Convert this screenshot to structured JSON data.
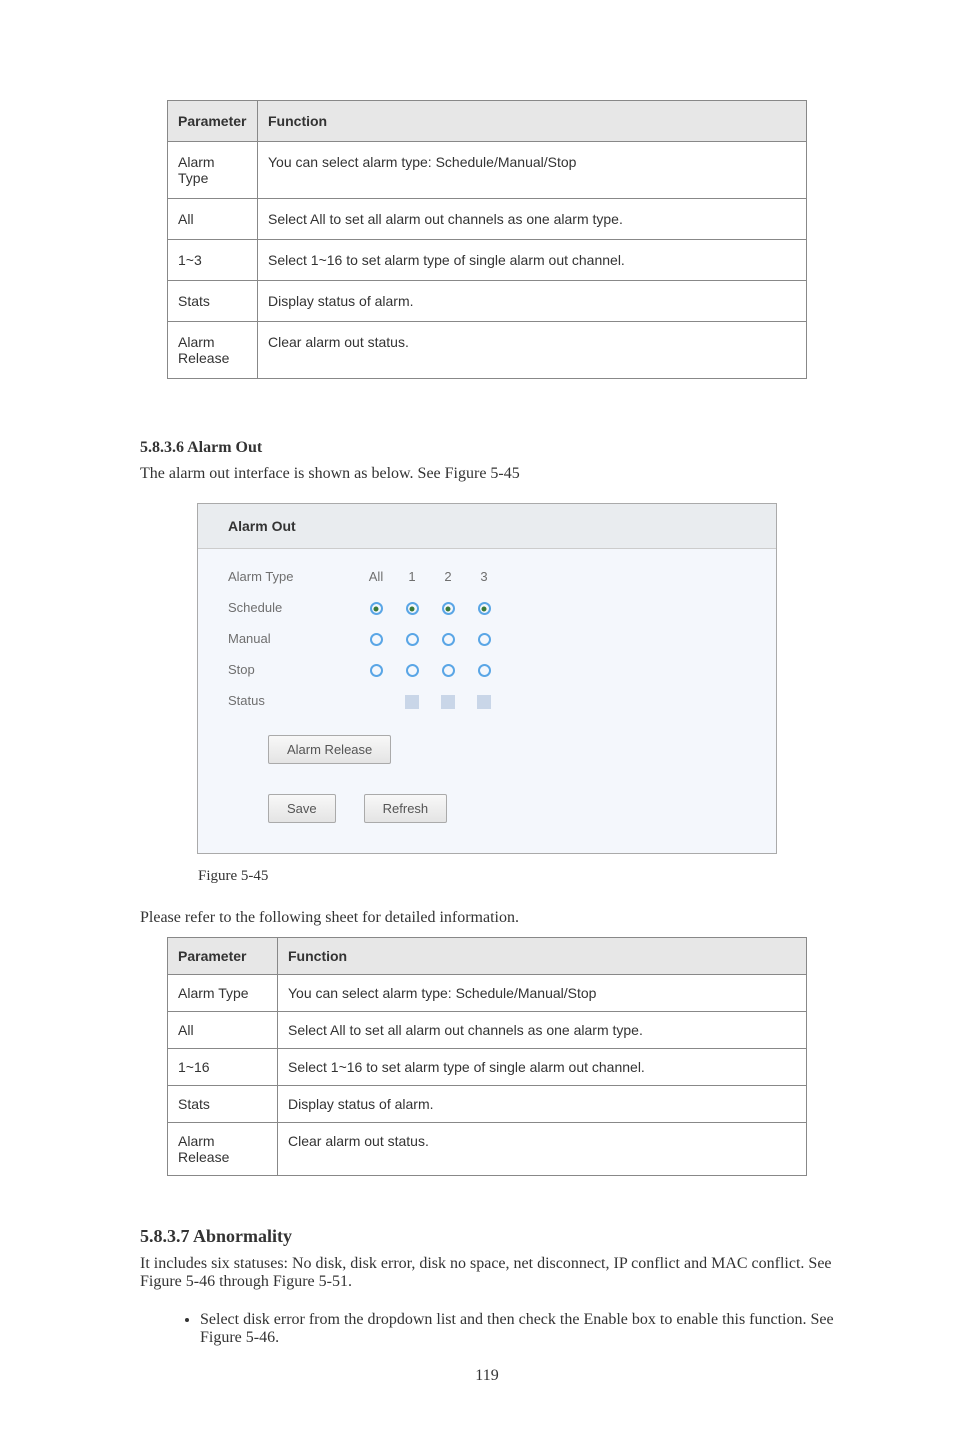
{
  "table1": {
    "headers": [
      "Parameter",
      "Function"
    ],
    "rows": [
      [
        "Alarm Type",
        "You can select alarm type: Schedule/Manual/Stop"
      ],
      [
        "All",
        "Select All to set all alarm out channels as one alarm type."
      ],
      [
        "1~3",
        "Select 1~16 to set alarm type of single alarm out channel."
      ],
      [
        "Stats",
        "Display status of alarm."
      ],
      [
        "Alarm Release",
        "Clear alarm out status."
      ]
    ]
  },
  "section1": {
    "num": "5.8.3.6",
    "title": "Alarm Out",
    "intro_a": "The alarm out interface is shown as below. See ",
    "intro_link": "Figure 5-45",
    "fig_label": "Figure 5-45",
    "post_fig": "Please refer to the following sheet for detailed information."
  },
  "alarm_out_panel": {
    "title": "Alarm Out",
    "col_labels": [
      "All",
      "1",
      "2",
      "3"
    ],
    "rows": [
      {
        "label": "Alarm Type"
      },
      {
        "label": "Schedule",
        "radios": [
          true,
          true,
          true,
          true
        ]
      },
      {
        "label": "Manual",
        "radios": [
          false,
          false,
          false,
          false
        ]
      },
      {
        "label": "Stop",
        "radios": [
          false,
          false,
          false,
          false
        ]
      },
      {
        "label": "Status"
      }
    ],
    "alarm_release_btn": "Alarm Release",
    "save_btn": "Save",
    "refresh_btn": "Refresh"
  },
  "table2": {
    "headers": [
      "Parameter",
      "Function"
    ],
    "rows": [
      [
        "Alarm Type",
        "You can select alarm type: Schedule/Manual/Stop"
      ],
      [
        "All",
        "Select All to set all alarm out channels as one alarm type."
      ],
      [
        "1~16",
        "Select 1~16 to set alarm type of single alarm out channel."
      ],
      [
        "Stats",
        "Display status of alarm."
      ],
      [
        "Alarm Release",
        "Clear alarm out status."
      ]
    ]
  },
  "section2": {
    "num": "5.8.3.7",
    "title": "Abnormality",
    "intro": "It includes six statuses: No disk, disk error, disk no space, net disconnect, IP conflict and MAC conflict. See Figure 5-46 through Figure 5-51.",
    "bullet1": "Select disk error from the dropdown list and then check the Enable box to enable this function. See Figure 5-46."
  },
  "page_num": "119"
}
